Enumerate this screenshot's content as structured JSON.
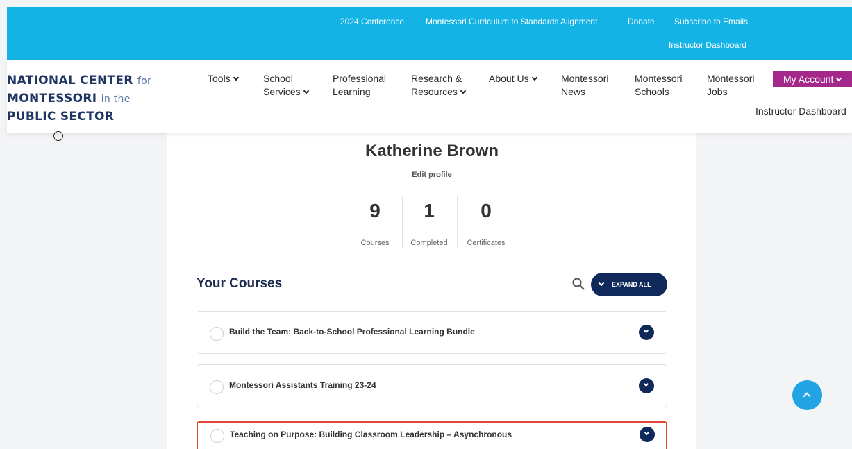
{
  "topbar": {
    "links": [
      "2024 Conference",
      "Montessori Curriculum to Standards Alignment",
      "Donate",
      "Subscribe to Emails"
    ],
    "instructor_dashboard": "Instructor Dashboard"
  },
  "logo": {
    "line1_bold": "NATIONAL CENTER",
    "line1_small": "for",
    "line2_bold": "MONTESSORI",
    "line2_small": "in the",
    "line3_bold": "PUBLIC SECTOR"
  },
  "nav": {
    "tools": "Tools",
    "school_services_1": "School",
    "school_services_2": "Services",
    "prof_learning_1": "Professional",
    "prof_learning_2": "Learning",
    "research_1": "Research &",
    "research_2": "Resources",
    "about": "About Us",
    "news_1": "Montessori",
    "news_2": "News",
    "schools_1": "Montessori",
    "schools_2": "Schools",
    "jobs_1": "Montessori",
    "jobs_2": "Jobs",
    "my_account": "My Account",
    "instructor_dashboard": "Instructor Dashboard"
  },
  "profile": {
    "name": "Katherine Brown",
    "edit_label": "Edit profile",
    "stats": [
      {
        "num": "9",
        "label": "Courses"
      },
      {
        "num": "1",
        "label": "Completed"
      },
      {
        "num": "0",
        "label": "Certificates"
      }
    ]
  },
  "courses": {
    "heading": "Your Courses",
    "expand_label": "EXPAND ALL",
    "items": [
      {
        "title": "Build the Team: Back-to-School Professional Learning Bundle"
      },
      {
        "title": "Montessori Assistants Training 23-24"
      },
      {
        "title": "Teaching on Purpose: Building Classroom Leadership – Asynchronous"
      }
    ]
  },
  "colors": {
    "topbar": "#14b3e5",
    "navy": "#0f2a5a",
    "account": "#a3288a",
    "highlight": "#e0483b"
  }
}
